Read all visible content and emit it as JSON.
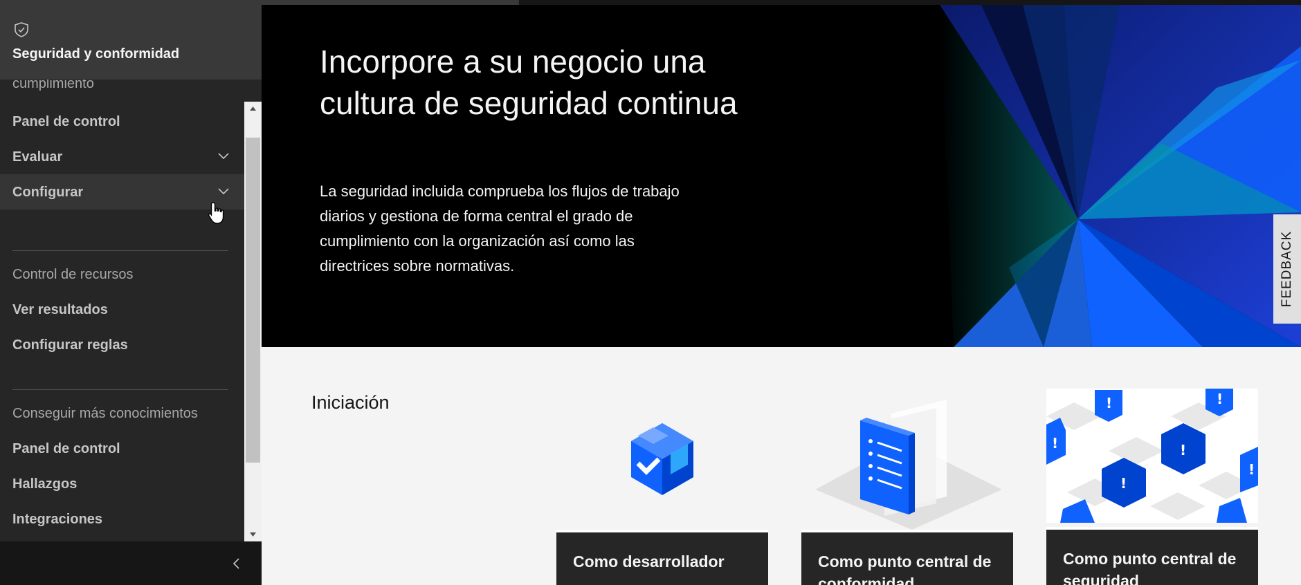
{
  "sidebar": {
    "title": "Seguridad y conformidad",
    "icon": "shield-check-icon",
    "items": [
      {
        "label": "cumplimiento"
      },
      {
        "label": "Panel de control"
      },
      {
        "label": "Evaluar"
      },
      {
        "label": "Configurar"
      },
      {
        "label": "Control de recursos"
      },
      {
        "label": "Ver resultados"
      },
      {
        "label": "Configurar reglas"
      },
      {
        "label": "Conseguir más conocimientos"
      },
      {
        "label": "Panel de control"
      },
      {
        "label": "Hallazgos"
      },
      {
        "label": "Integraciones"
      }
    ]
  },
  "hero": {
    "headline": "Incorpore a su negocio una cultura de seguridad continua",
    "body": "La seguridad incluida comprueba los flujos de trabajo diarios y gestiona de forma central el grado de cumplimiento con la organización así como las directrices sobre normativas."
  },
  "feedback": {
    "label": "FEEDBACK"
  },
  "getting_started": {
    "title": "Iniciación",
    "cards": [
      {
        "label": "Como desarrollador",
        "icon": "cube-check-icon"
      },
      {
        "label": "Como punto central de conformidad",
        "icon": "checklist-document-icon"
      },
      {
        "label": "Como punto central de seguridad",
        "icon": "alert-cubes-pattern-icon"
      }
    ]
  },
  "colors": {
    "sidebar_bg": "#262626",
    "accent_blue": "#0f62fe",
    "hero_bg": "#000000"
  }
}
